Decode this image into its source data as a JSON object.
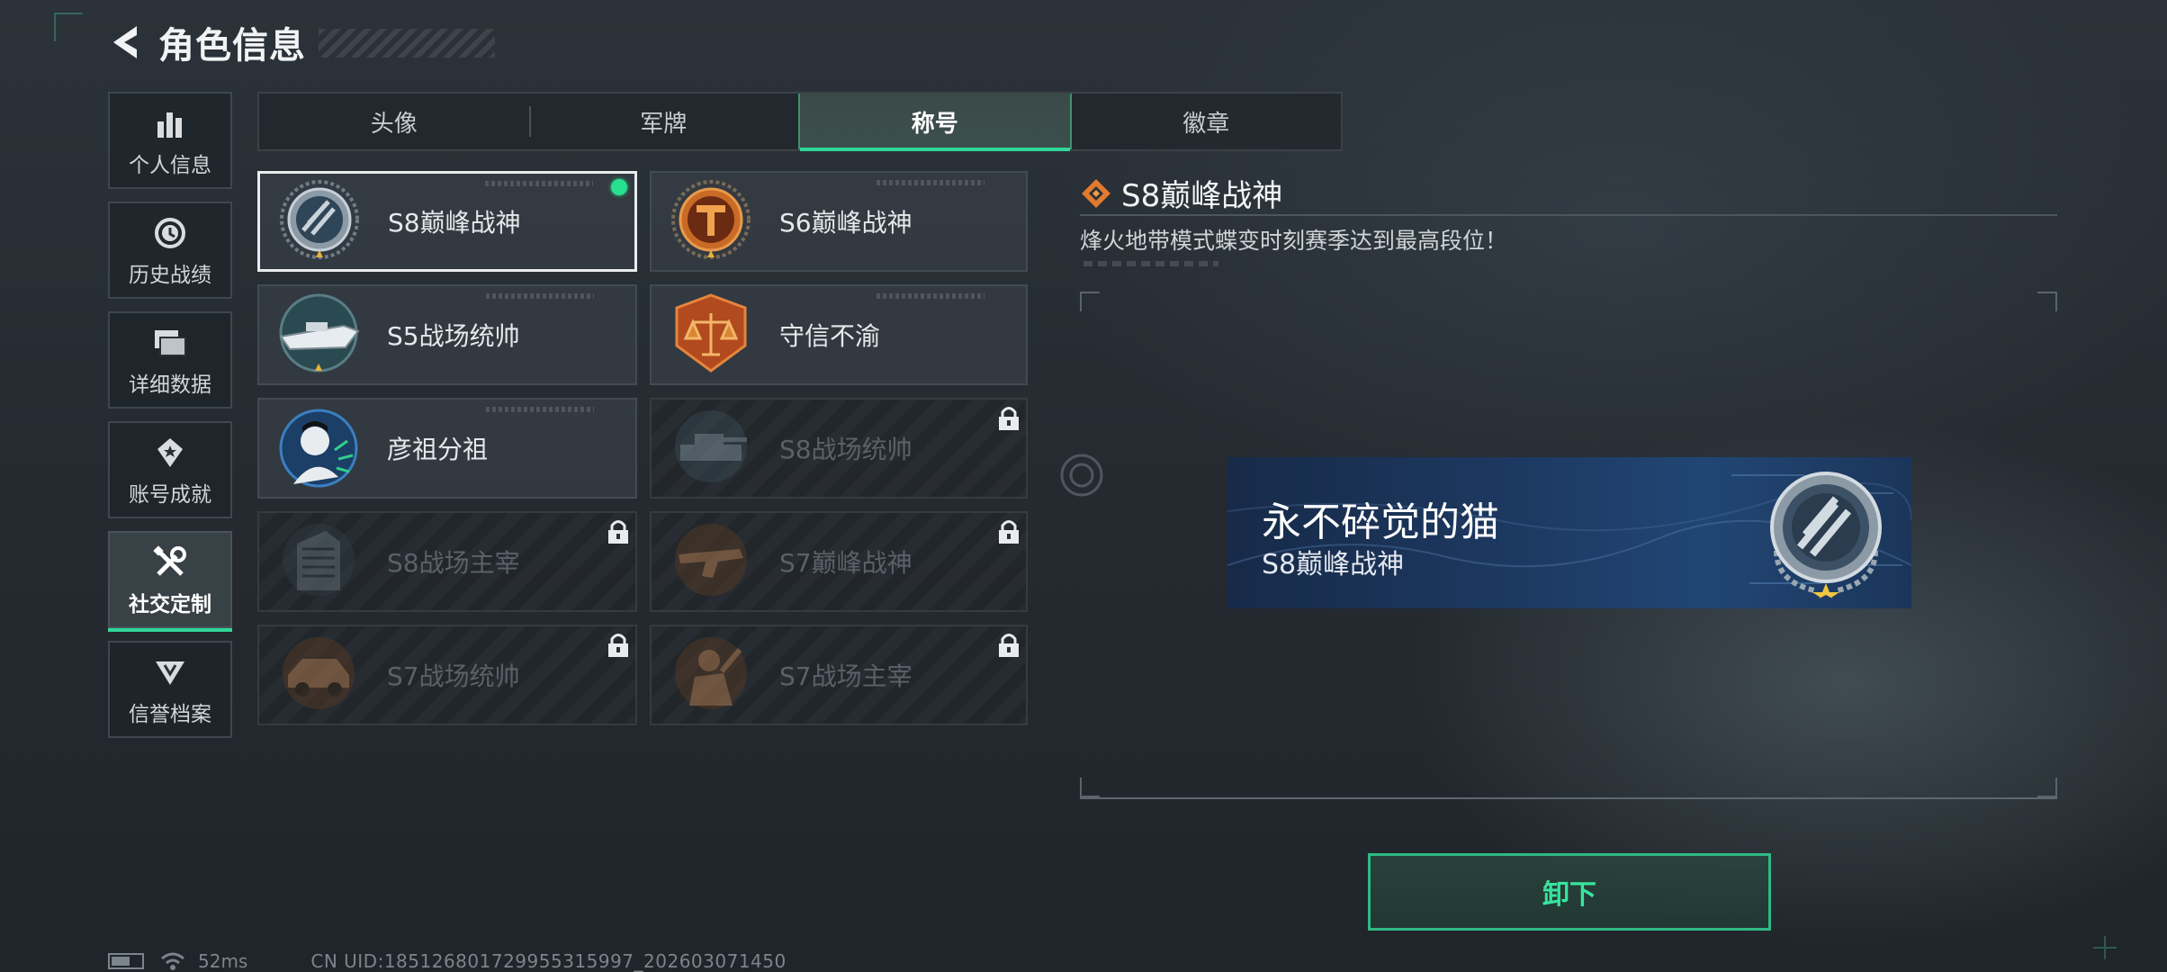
{
  "header": {
    "title": "角色信息"
  },
  "nav": [
    {
      "label": "个人信息",
      "icon": "bar-chart-icon",
      "active": false
    },
    {
      "label": "历史战绩",
      "icon": "clock-icon",
      "active": false
    },
    {
      "label": "详细数据",
      "icon": "folder-icon",
      "active": false
    },
    {
      "label": "账号成就",
      "icon": "achievement-icon",
      "active": false
    },
    {
      "label": "社交定制",
      "icon": "tools-icon",
      "active": true
    },
    {
      "label": "信誉档案",
      "icon": "credit-icon",
      "active": false
    }
  ],
  "tabs": [
    {
      "label": "头像",
      "active": false
    },
    {
      "label": "军牌",
      "active": false
    },
    {
      "label": "称号",
      "active": true
    },
    {
      "label": "徽章",
      "active": false
    }
  ],
  "titles": [
    {
      "name": "S8巅峰战神",
      "medal": "blue-stripes",
      "selected": true,
      "equipped": true,
      "locked": false
    },
    {
      "name": "S6巅峰战神",
      "medal": "bronze-t",
      "selected": false,
      "equipped": false,
      "locked": false
    },
    {
      "name": "S5战场统帅",
      "medal": "boat",
      "selected": false,
      "equipped": false,
      "locked": false
    },
    {
      "name": "守信不渝",
      "medal": "scales",
      "selected": false,
      "equipped": false,
      "locked": false
    },
    {
      "name": "彦祖分祖",
      "medal": "portrait",
      "selected": false,
      "equipped": false,
      "locked": false
    },
    {
      "name": "S8战场统帅",
      "medal": "tank",
      "selected": false,
      "equipped": false,
      "locked": true
    },
    {
      "name": "S8战场主宰",
      "medal": "building",
      "selected": false,
      "equipped": false,
      "locked": true
    },
    {
      "name": "S7巅峰战神",
      "medal": "gun",
      "selected": false,
      "equipped": false,
      "locked": true
    },
    {
      "name": "S7战场统帅",
      "medal": "vehicle",
      "selected": false,
      "equipped": false,
      "locked": true
    },
    {
      "name": "S7战场主宰",
      "medal": "soldier",
      "selected": false,
      "equipped": false,
      "locked": true
    }
  ],
  "detail": {
    "title": "S8巅峰战神",
    "description": "烽火地带模式蝶变时刻赛季达到最高段位！",
    "preview_player": "永不碎觉的猫",
    "preview_title": "S8巅峰战神",
    "action": "卸下"
  },
  "status": {
    "ping": "52ms",
    "uid": "CN UID:185126801729955315997_202603071450"
  },
  "colors": {
    "accent": "#2fd89a",
    "medal_orange": "#e07a2e"
  }
}
